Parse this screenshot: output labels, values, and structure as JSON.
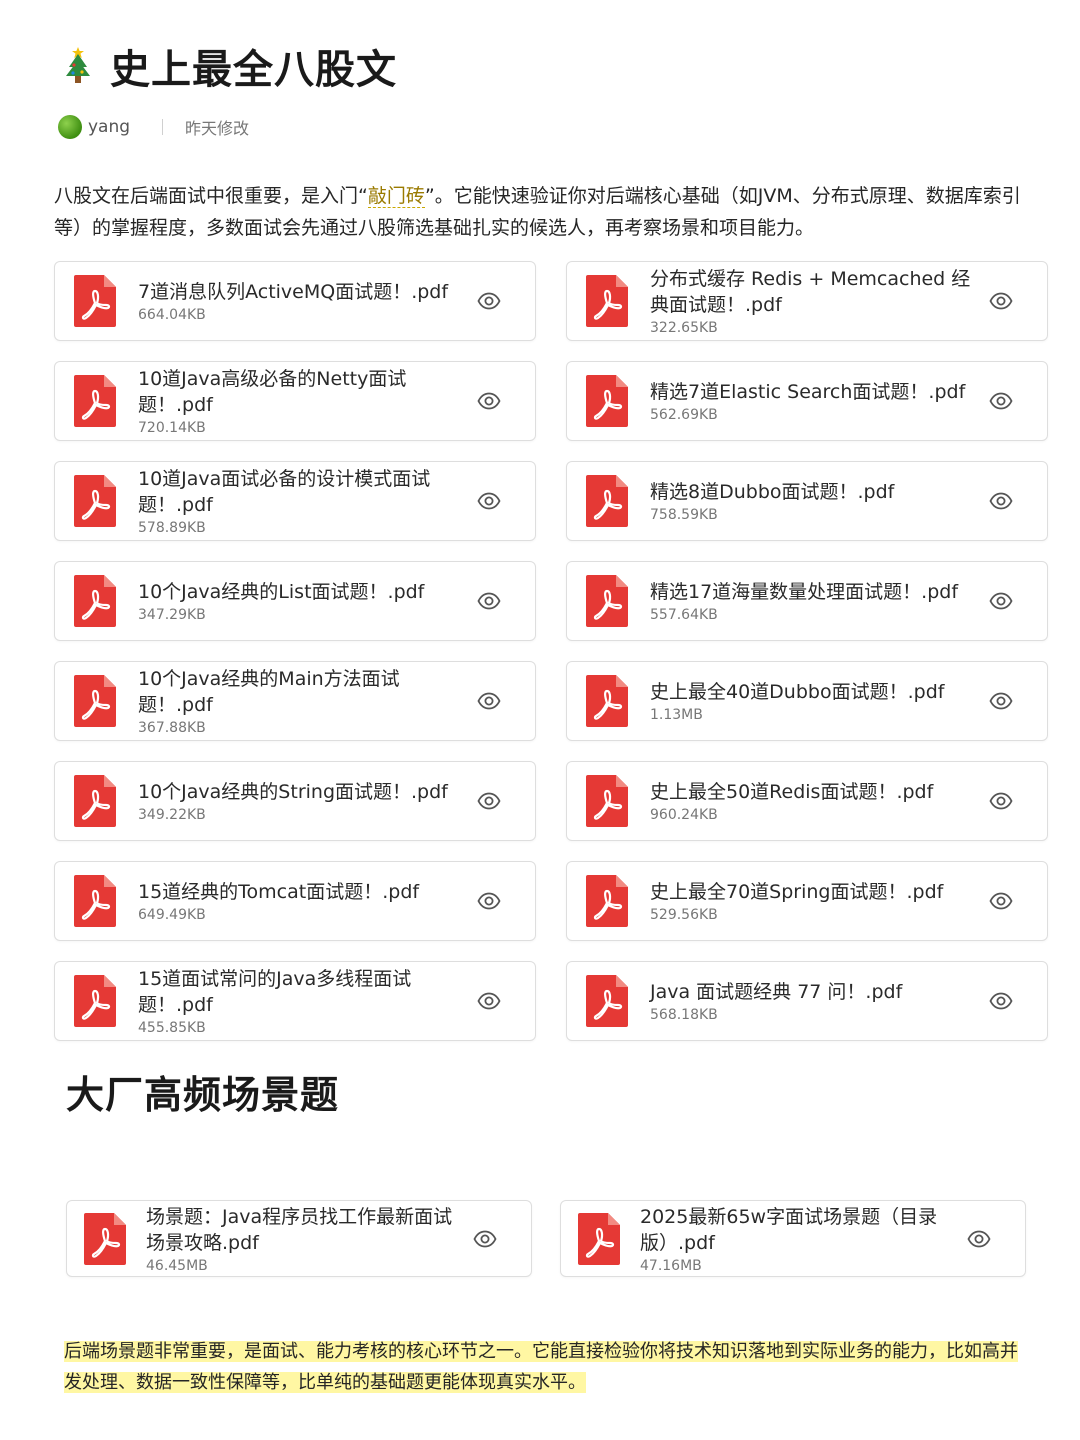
{
  "title": "史上最全八股文",
  "meta": {
    "author": "yang",
    "modified": "昨天修改"
  },
  "intro": {
    "before": "八股文在后端面试中很重要，是入门“",
    "highlight": "敲门砖",
    "after": "”。它能快速验证你对后端核心基础（如JVM、分布式原理、数据库索引等）的掌握程度，多数面试会先通过八股筛选基础扎实的候选人，再考察场景和项目能力。"
  },
  "files": [
    {
      "name": "7道消息队列ActiveMQ面试题！.pdf",
      "size": "664.04KB"
    },
    {
      "name": "分布式缓存 Redis + Memcached 经典面试题！.pdf",
      "size": "322.65KB"
    },
    {
      "name": "10道Java高级必备的Netty面试题！.pdf",
      "size": "720.14KB"
    },
    {
      "name": "精选7道Elastic Search面试题！.pdf",
      "size": "562.69KB"
    },
    {
      "name": "10道Java面试必备的设计模式面试题！.pdf",
      "size": "578.89KB"
    },
    {
      "name": "精选8道Dubbo面试题！.pdf",
      "size": "758.59KB"
    },
    {
      "name": "10个Java经典的List面试题！.pdf",
      "size": "347.29KB"
    },
    {
      "name": "精选17道海量数量处理面试题！.pdf",
      "size": "557.64KB"
    },
    {
      "name": "10个Java经典的Main方法面试题！.pdf",
      "size": "367.88KB"
    },
    {
      "name": "史上最全40道Dubbo面试题！.pdf",
      "size": "1.13MB"
    },
    {
      "name": "10个Java经典的String面试题！.pdf",
      "size": "349.22KB"
    },
    {
      "name": "史上最全50道Redis面试题！.pdf",
      "size": "960.24KB"
    },
    {
      "name": "15道经典的Tomcat面试题！.pdf",
      "size": "649.49KB"
    },
    {
      "name": "史上最全70道Spring面试题！.pdf",
      "size": "529.56KB"
    },
    {
      "name": "15道面试常问的Java多线程面试题！.pdf",
      "size": "455.85KB"
    },
    {
      "name": "Java 面试题经典 77 问！.pdf",
      "size": "568.18KB"
    }
  ],
  "section2": {
    "title": "大厂高频场景题",
    "files": [
      {
        "name": "场景题：Java程序员找工作最新面试场景攻略.pdf",
        "size": "46.45MB"
      },
      {
        "name": "2025最新65w字面试场景题（目录版）.pdf",
        "size": "47.16MB"
      }
    ]
  },
  "footer_note": "后端场景题非常重要，是面试、能力考核的核心环节之一。它能直接检验你将技术知识落地到实际业务的能力，比如高并发处理、数据一致性保障等，比单纯的基础题更能体现真实水平。",
  "icons": {
    "file": "pdf-icon",
    "preview": "eye-icon",
    "title": "christmas-tree-icon"
  },
  "colors": {
    "pdf_red": "#e53935",
    "highlight": "#fff7a3"
  }
}
